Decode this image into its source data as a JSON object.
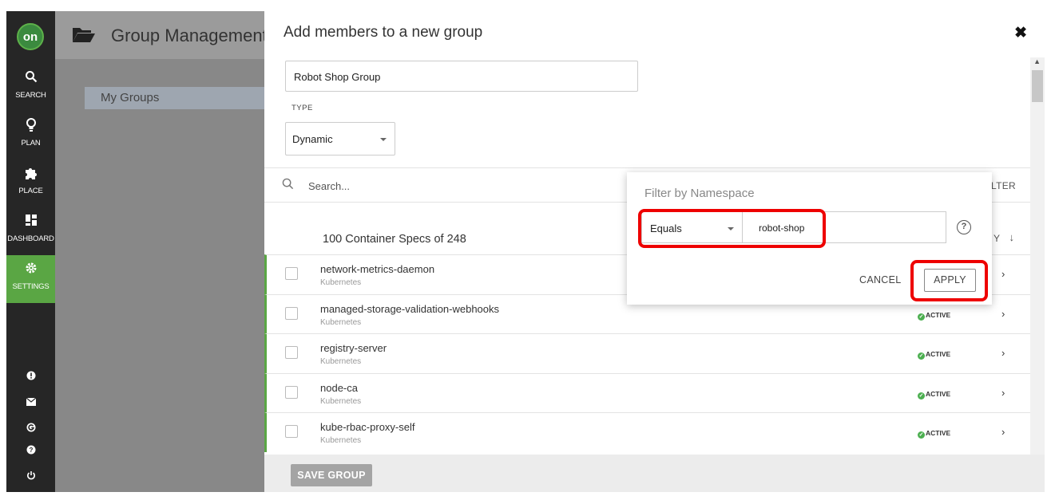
{
  "nav": {
    "logo": "on",
    "items": [
      {
        "label": "SEARCH",
        "icon": "search-icon"
      },
      {
        "label": "PLAN",
        "icon": "lightbulb-icon"
      },
      {
        "label": "PLACE",
        "icon": "puzzle-icon"
      },
      {
        "label": "DASHBOARD",
        "icon": "dashboard-icon"
      },
      {
        "label": "SETTINGS",
        "icon": "gear-icon",
        "active": true
      }
    ],
    "bottom_icons": [
      "alert-icon",
      "mail-icon",
      "g-icon",
      "help-icon",
      "power-icon"
    ]
  },
  "page": {
    "title": "Group Management",
    "sidebar_item": "My Groups"
  },
  "modal": {
    "title": "Add members to a new group",
    "group_name": "Robot Shop Group",
    "type_label": "TYPE",
    "type_value": "Dynamic",
    "search_placeholder": "Search...",
    "filter_label": "LTER",
    "count_text": "100 Container Specs of 248",
    "sort_label": "Y",
    "rows": [
      {
        "name": "network-metrics-daemon",
        "sub": "Kubernetes",
        "status": ""
      },
      {
        "name": "managed-storage-validation-webhooks",
        "sub": "Kubernetes",
        "status": "ACTIVE"
      },
      {
        "name": "registry-server",
        "sub": "Kubernetes",
        "status": "ACTIVE"
      },
      {
        "name": "node-ca",
        "sub": "Kubernetes",
        "status": "ACTIVE"
      },
      {
        "name": "kube-rbac-proxy-self",
        "sub": "Kubernetes",
        "status": "ACTIVE"
      }
    ],
    "save_button": "SAVE GROUP"
  },
  "filter_popover": {
    "title": "Filter by Namespace",
    "operator": "Equals",
    "value": "robot-shop",
    "cancel": "CANCEL",
    "apply": "APPLY"
  },
  "colors": {
    "nav_bg": "#262626",
    "accent_green": "#5aa644",
    "highlight_red": "#e00000"
  }
}
